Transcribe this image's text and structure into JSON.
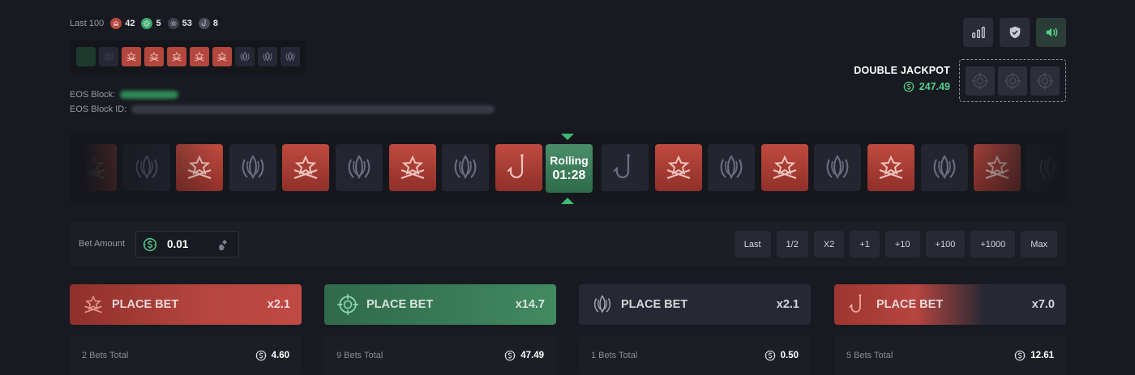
{
  "history": {
    "label": "Last 100",
    "t_count": "42",
    "bonus_count": "5",
    "ct_count": "53",
    "hook_count": "8",
    "recent": [
      "bonus",
      "ct",
      "t",
      "t",
      "t",
      "t",
      "t",
      "ct",
      "ct",
      "ct"
    ]
  },
  "eos": {
    "block_label": "EOS Block:",
    "block_id_label": "EOS Block ID:"
  },
  "jackpot": {
    "title": "DOUBLE JACKPOT",
    "value": "247.49"
  },
  "roller": {
    "tiles": [
      "t",
      "ct",
      "t",
      "ct",
      "t",
      "ct",
      "t",
      "ct",
      "hook",
      "ROLL",
      "hookct",
      "t",
      "ct",
      "t",
      "ct",
      "t",
      "ct",
      "t",
      "ct"
    ],
    "rolling_label": "Rolling",
    "timer": "01:28"
  },
  "bet": {
    "label": "Bet Amount",
    "amount": "0.01",
    "quick_buttons": [
      "Last",
      "1/2",
      "X2",
      "+1",
      "+10",
      "+100",
      "+1000",
      "Max"
    ]
  },
  "columns": [
    {
      "kind": "t",
      "label": "PLACE BET",
      "multiplier": "x2.1",
      "total_label": "2 Bets Total",
      "total_value": "4.60"
    },
    {
      "kind": "bonus",
      "label": "PLACE BET",
      "multiplier": "x14.7",
      "total_label": "9 Bets Total",
      "total_value": "47.49"
    },
    {
      "kind": "ct",
      "label": "PLACE BET",
      "multiplier": "x2.1",
      "total_label": "1 Bets Total",
      "total_value": "0.50"
    },
    {
      "kind": "hook",
      "label": "PLACE BET",
      "multiplier": "x7.0",
      "total_label": "5 Bets Total",
      "total_value": "12.61"
    }
  ],
  "colors": {
    "accent_green": "#52d08a",
    "t_red": "#b74540",
    "bonus_green": "#3a7c58",
    "ct_dark": "#262934"
  }
}
